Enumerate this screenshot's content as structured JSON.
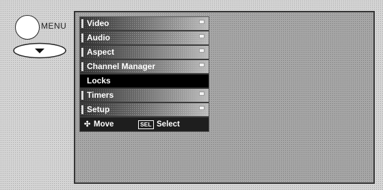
{
  "remote": {
    "menu_label": "MENU",
    "menu_button_icon": "circle-button-icon",
    "down_button_icon": "down-arrow-oval-icon"
  },
  "menu": {
    "items": [
      {
        "label": "Video",
        "selected": false
      },
      {
        "label": "Audio",
        "selected": false
      },
      {
        "label": "Aspect",
        "selected": false
      },
      {
        "label": "Channel Manager",
        "selected": false
      },
      {
        "label": "Locks",
        "selected": true
      },
      {
        "label": "Timers",
        "selected": false
      },
      {
        "label": "Setup",
        "selected": false
      }
    ]
  },
  "help": {
    "move_icon": "✣",
    "move_label": "Move",
    "sel_icon": "SEL",
    "select_label": "Select"
  },
  "colors": {
    "selected_bg": "#000000",
    "screen_bg": "#a6a6a6",
    "page_bg": "#d4d4d4"
  }
}
